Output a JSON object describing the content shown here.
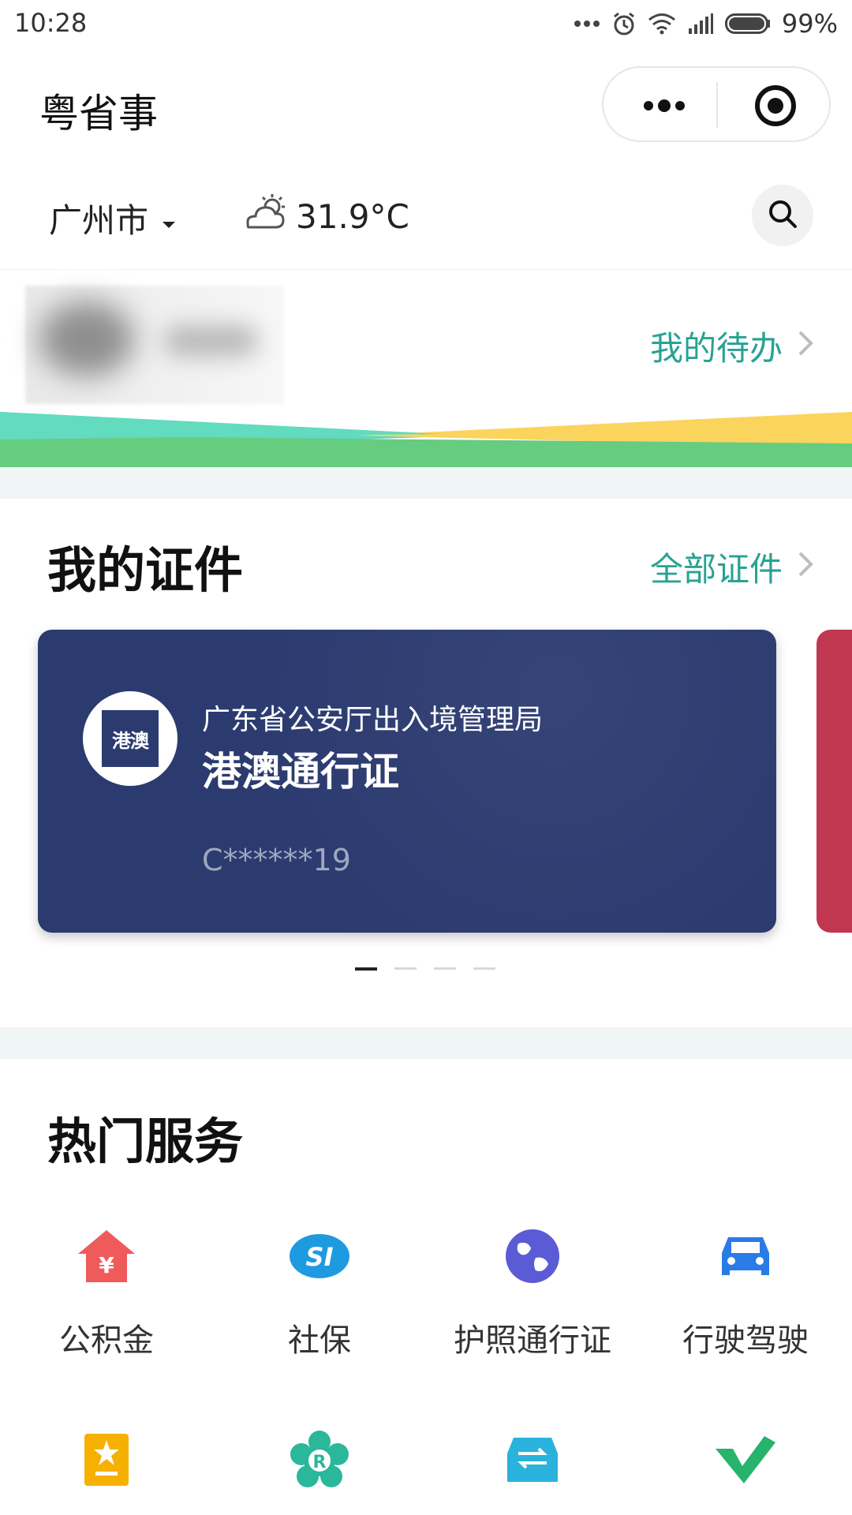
{
  "status_bar": {
    "time": "10:28",
    "battery": "99%"
  },
  "nav": {
    "title": "粤省事",
    "more_icon": "more-dots-icon",
    "close_icon": "target-circle-icon"
  },
  "location": {
    "city": "广州市",
    "temperature": "31.9°C",
    "weather_icon": "partly-cloudy-icon",
    "search_icon": "search-icon"
  },
  "user_panel": {
    "todo_label": "我的待办"
  },
  "certificates": {
    "title": "我的证件",
    "all_label": "全部证件",
    "cards": [
      {
        "issuer": "广东省公安厅出入境管理局",
        "name": "港澳通行证",
        "number": "C******19",
        "logo_text": "港澳",
        "color": "#2b3a6f"
      }
    ],
    "next_card_color": "#c0384f",
    "page_count": 4,
    "active_page": 1
  },
  "hot_services": {
    "title": "热门服务",
    "items": [
      {
        "label": "公积金",
        "icon": "housing-fund-icon",
        "color": "#ef5b5b"
      },
      {
        "label": "社保",
        "icon": "social-security-icon",
        "color": "#1e9be0"
      },
      {
        "label": "护照通行证",
        "icon": "globe-passport-icon",
        "color": "#5b5bd6"
      },
      {
        "label": "行驶驾驶",
        "icon": "car-icon",
        "color": "#2b7be6"
      },
      {
        "label": "",
        "icon": "star-badge-icon",
        "color": "#f6b100"
      },
      {
        "label": "",
        "icon": "disability-flower-icon",
        "color": "#2bb79a"
      },
      {
        "label": "",
        "icon": "transfer-vehicle-icon",
        "color": "#29b3dc"
      },
      {
        "label": "",
        "icon": "check-v-icon",
        "color": "#27b36b"
      }
    ]
  },
  "colors": {
    "accent": "#27a293",
    "band": "#f0f5f5"
  }
}
